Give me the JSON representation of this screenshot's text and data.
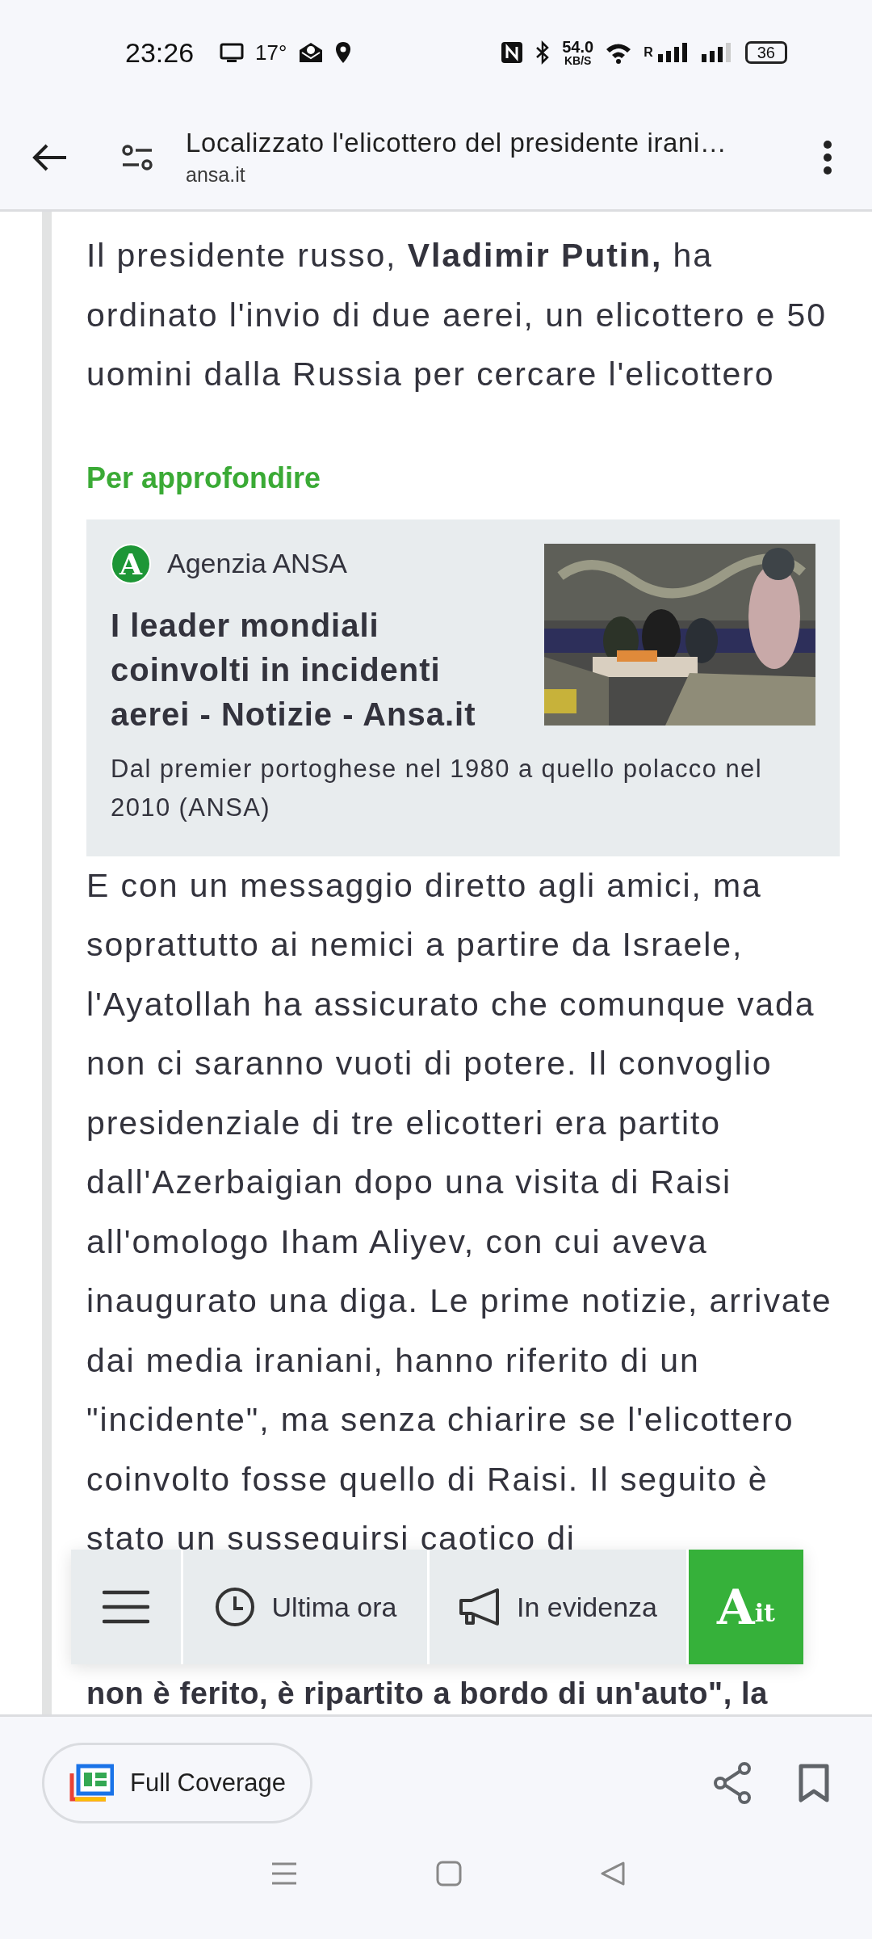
{
  "status_bar": {
    "time": "23:26",
    "temperature": "17°",
    "speed": "54.0",
    "speed_unit": "KB/S",
    "roaming": "R",
    "battery": "36"
  },
  "header": {
    "title": "Localizzato l'elicottero del presidente irani…",
    "domain": "ansa.it"
  },
  "article": {
    "paragraph_1": "Il presidente russo, **Vladimir Putin,** ha ordinato l'invio di due aerei, un elicottero e 50 uomini dalla Russia per cercare l'elicottero",
    "section_heading": "Per approfondire",
    "related": {
      "source": "Agenzia ANSA",
      "logo": "A",
      "title": "I leader mondiali coinvolti in incidenti aerei - Notizie - Ansa.it",
      "description": "Dal premier portoghese nel 1980 a quello polacco nel 2010 (ANSA)"
    },
    "paragraph_2": "E con un messaggio diretto agli amici, ma soprattutto ai nemici a partire da Israele, l'Ayatollah ha assicurato che comunque vada non ci saranno vuoti di potere. Il convoglio presidenziale di tre elicotteri era partito dall'Azerbaigian dopo una visita di Raisi all'omologo Iham Aliyev, con cui aveva inaugurato una diga. Le prime notizie, arrivate dai media iraniani, hanno riferito di un \"incidente\", ma senza chiarire se l'elicottero coinvolto fosse quello di Raisi. Il seguito è stato un susseguirsi caotico di",
    "partial_line": "non è ferito, è ripartito a bordo di un'auto\", la"
  },
  "site_toolbar": {
    "items": [
      {
        "kind": "menu"
      },
      {
        "kind": "clock",
        "label": "Ultima ora"
      },
      {
        "kind": "megaphone",
        "label": "In evidenza"
      },
      {
        "kind": "brand",
        "letter": "A",
        "suffix": "it"
      }
    ]
  },
  "bottom_bar": {
    "full_coverage": "Full Coverage"
  }
}
